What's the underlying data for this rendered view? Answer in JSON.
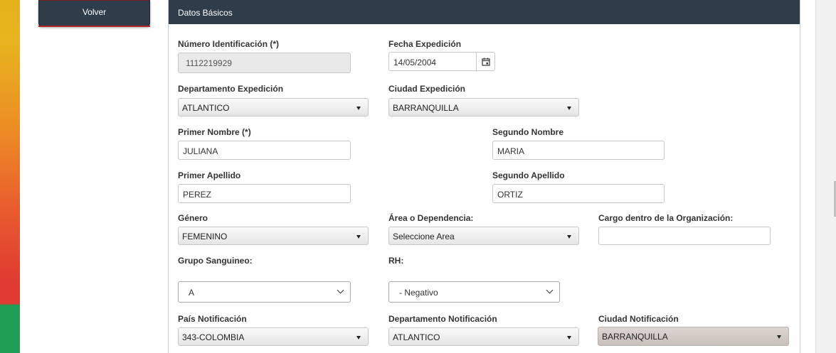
{
  "nav": {
    "back_label": "Volver"
  },
  "panel": {
    "title": "Datos Básicos"
  },
  "form": {
    "numero_identificacion": {
      "label": "Número Identificación (*)",
      "value": "1112219929"
    },
    "fecha_expedicion": {
      "label": "Fecha Expedición",
      "value": "14/05/2004"
    },
    "departamento_expedicion": {
      "label": "Departamento Expedición",
      "value": "ATLANTICO"
    },
    "ciudad_expedicion": {
      "label": "Ciudad Expedición",
      "value": "BARRANQUILLA"
    },
    "primer_nombre": {
      "label": "Primer Nombre (*)",
      "value": "JULIANA"
    },
    "segundo_nombre": {
      "label": "Segundo Nombre",
      "value": "MARIA"
    },
    "primer_apellido": {
      "label": "Primer Apellido",
      "value": "PEREZ"
    },
    "segundo_apellido": {
      "label": "Segundo Apellido",
      "value": "ORTIZ"
    },
    "genero": {
      "label": "Género",
      "value": "FEMENINO"
    },
    "area": {
      "label": "Área o Dependencia:",
      "value": "Seleccione Area"
    },
    "cargo": {
      "label": "Cargo dentro de la Organización:",
      "value": ""
    },
    "grupo_sanguineo": {
      "label": "Grupo Sanguineo:",
      "value": "A"
    },
    "rh": {
      "label": "RH:",
      "value": "- Negativo"
    },
    "pais_notificacion": {
      "label": "País Notificación",
      "value": "343-COLOMBIA"
    },
    "departamento_notificacion": {
      "label": "Departamento Notificación",
      "value": "ATLANTICO"
    },
    "ciudad_notificacion": {
      "label": "Ciudad Notificación",
      "value": "BARRANQUILLA"
    }
  },
  "icons": {
    "calendar": "calendar-icon",
    "dropdown": "caret-down-icon",
    "select_chevron": "chevron-down-icon"
  },
  "colors": {
    "header_bg": "#2f3d4b",
    "accent_red": "#b3262a",
    "stripe_green": "#1f9d55"
  }
}
